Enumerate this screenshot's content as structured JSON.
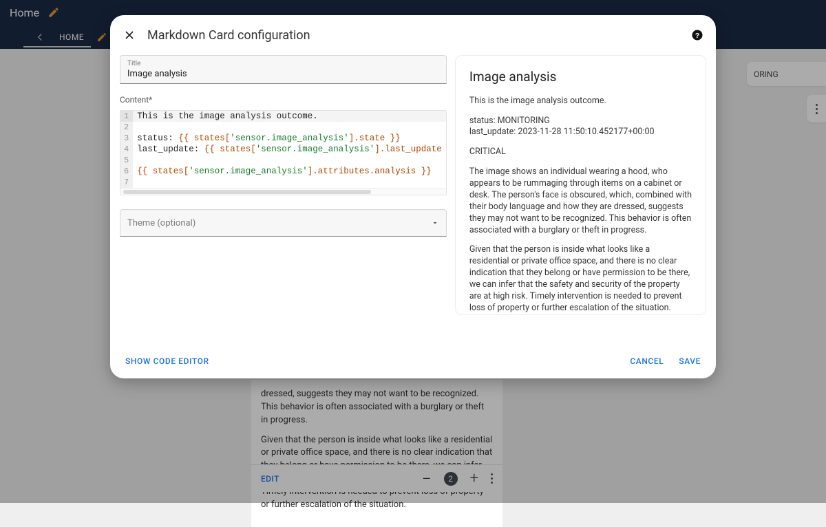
{
  "bg": {
    "home": "Home",
    "homeTab": "HOME",
    "rightChip": "ORING",
    "cardP1": "dressed, suggests they may not want to be recognized. This behavior is often associated with a burglary or theft in progress.",
    "cardP2": "Given that the person is inside what looks like a residential or private office space, and there is no clear indication that they belong or have permission to be there, we can infer that the safety and security of the property are at high risk. Timely intervention is needed to prevent loss of property or further escalation of the situation.",
    "edit": "EDIT",
    "badge": "2"
  },
  "dialog": {
    "title": "Markdown Card configuration",
    "titleField": {
      "label": "Title",
      "value": "Image analysis"
    },
    "contentLabel": "Content*",
    "code": {
      "l1": "This is the image analysis outcome.",
      "l3a": "status: ",
      "l3b": "{{ states[",
      "l3c": "'sensor.image_analysis'",
      "l3d": "].state }}",
      "l4a": "last_update: ",
      "l4b": "{{ states[",
      "l4c": "'sensor.image_analysis'",
      "l4d": "].last_update",
      "l6a": " {{ states[",
      "l6b": "'sensor.image_analysis'",
      "l6c": "].attributes.analysis }}"
    },
    "themeLabel": "Theme (optional)",
    "preview": {
      "heading": "Image analysis",
      "p1": "This is the image analysis outcome.",
      "p2": "status: MONITORING",
      "p3": "last_update: 2023-11-28 11:50:10.452177+00:00",
      "p4": "CRITICAL",
      "p5": "The image shows an individual wearing a hood, who appears to be rummaging through items on a cabinet or desk. The person's face is obscured, which, combined with their body language and how they are dressed, suggests they may not want to be recognized. This behavior is often associated with a burglary or theft in progress.",
      "p6": "Given that the person is inside what looks like a residential or private office space, and there is no clear indication that they belong or have permission to be there, we can infer that the safety and security of the property are at high risk. Timely intervention is needed to prevent loss of property or further escalation of the situation."
    },
    "footer": {
      "showCode": "SHOW CODE EDITOR",
      "cancel": "CANCEL",
      "save": "SAVE"
    }
  }
}
